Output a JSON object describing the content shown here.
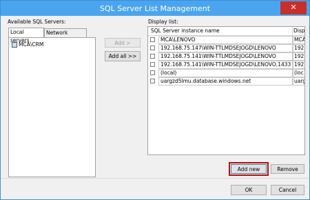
{
  "window": {
    "title": "SQL Server List Management",
    "close_glyph": "✕"
  },
  "left": {
    "label": "Available SQL Servers:",
    "tabs": [
      "Local servers",
      "Network servers"
    ],
    "tree_items": [
      "MCA\\CRM"
    ]
  },
  "middle": {
    "add_label": "Add >",
    "add_all_label": "Add all >>"
  },
  "right": {
    "label": "Display list:",
    "columns": [
      "SQL Server instance name",
      "Disp"
    ],
    "rows": [
      {
        "name": "MCA\\LENOVO",
        "display": "MCA"
      },
      {
        "name": "192.168.75.147\\WIN-TTLMDSEJOGD\\LENOVO",
        "display": "192"
      },
      {
        "name": "192.168.75.141\\WIN-TTLMDSEJOGD\\LENOVO",
        "display": "192"
      },
      {
        "name": "192.168.75.141\\WIN-TTLMDSEJOGD\\LENOVO,1433",
        "display": "192"
      },
      {
        "name": "(local)",
        "display": "(loc"
      },
      {
        "name": "uargzd5lmu.database.windows.net",
        "display": "uarg"
      }
    ]
  },
  "buttons": {
    "add_new": "Add new",
    "remove": "Remove",
    "ok": "OK",
    "cancel": "Cancel"
  }
}
